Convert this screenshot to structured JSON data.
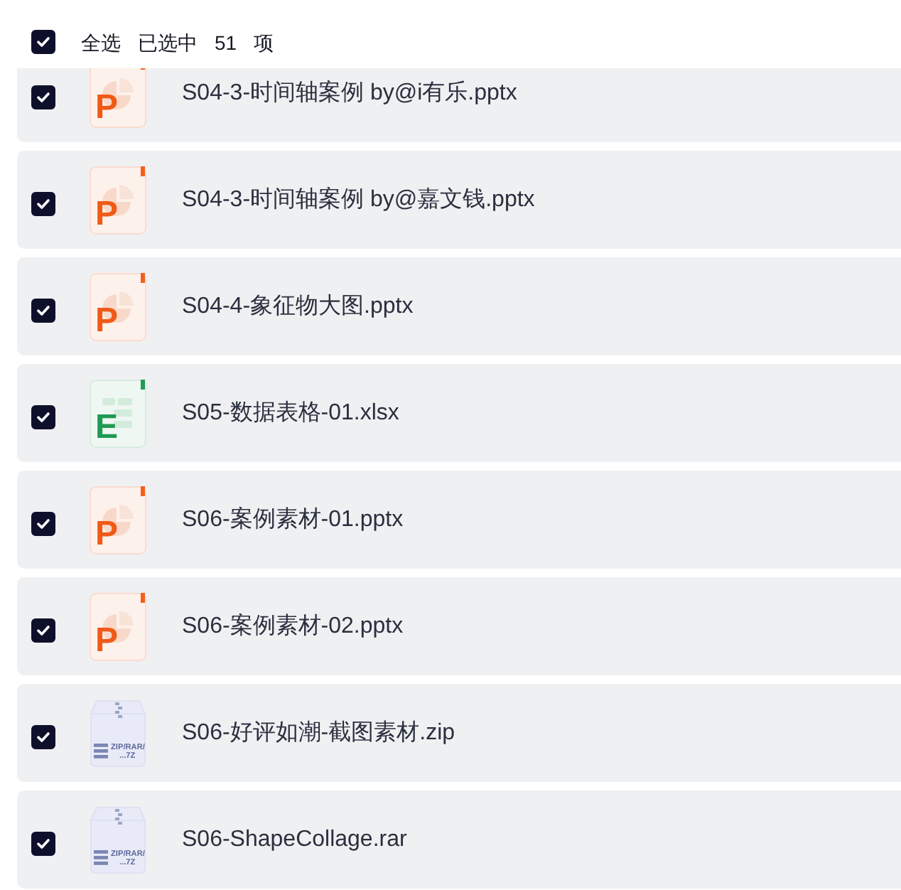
{
  "header": {
    "select_all": {
      "label": "全选",
      "checked": true
    },
    "status": {
      "prefix": "已选中",
      "count": "51",
      "suffix": "项"
    }
  },
  "files": [
    {
      "kind": "presentation",
      "icon_text": [
        "P"
      ],
      "name": "S04-3-时间轴案例 by@i有乐.pptx",
      "checked": true
    },
    {
      "kind": "presentation",
      "icon_text": [
        "P"
      ],
      "name": "S04-3-时间轴案例 by@嘉文钱.pptx",
      "checked": true
    },
    {
      "kind": "presentation",
      "icon_text": [
        "P"
      ],
      "name": "S04-4-象征物大图.pptx",
      "checked": true
    },
    {
      "kind": "spreadsheet",
      "icon_text": [
        "E"
      ],
      "name": "S05-数据表格-01.xlsx",
      "checked": true
    },
    {
      "kind": "presentation",
      "icon_text": [
        "P"
      ],
      "name": "S06-案例素材-01.pptx",
      "checked": true
    },
    {
      "kind": "presentation",
      "icon_text": [
        "P"
      ],
      "name": "S06-案例素材-02.pptx",
      "checked": true
    },
    {
      "kind": "archive",
      "icon_text": [
        "ZIP/RAR/",
        "...7Z"
      ],
      "name": "S06-好评如潮-截图素材.zip",
      "checked": true
    },
    {
      "kind": "archive",
      "icon_text": [
        "ZIP/RAR/",
        "...7Z"
      ],
      "name": "S06-ShapeCollage.rar",
      "checked": true
    }
  ]
}
